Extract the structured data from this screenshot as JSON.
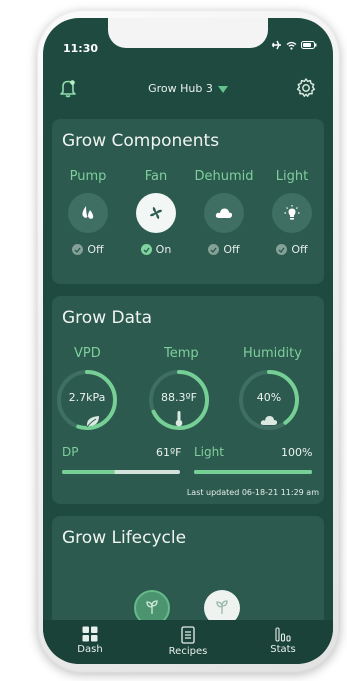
{
  "status_bar": {
    "time": "11:30"
  },
  "header": {
    "hub_name": "Grow Hub 3"
  },
  "components": {
    "title": "Grow Components",
    "items": [
      {
        "label": "Pump",
        "status": "Off",
        "icon": "drop-icon",
        "on": false
      },
      {
        "label": "Fan",
        "status": "On",
        "icon": "fan-icon",
        "on": true
      },
      {
        "label": "Dehumid",
        "status": "Off",
        "icon": "cloud-icon",
        "on": false
      },
      {
        "label": "Light",
        "status": "Off",
        "icon": "bulb-icon",
        "on": false
      }
    ]
  },
  "grow_data": {
    "title": "Grow Data",
    "gauges": [
      {
        "label": "VPD",
        "value": "2.7kPa",
        "fraction": 0.55,
        "icon": "leaf-icon"
      },
      {
        "label": "Temp",
        "value": "88.3ºF",
        "fraction": 0.68,
        "icon": "thermometer-icon"
      },
      {
        "label": "Humidity",
        "value": "40%",
        "fraction": 0.4,
        "icon": "cloud-icon"
      }
    ],
    "dp_label": "DP",
    "dp_value": "61ºF",
    "dp_fraction": 0.45,
    "light_label": "Light",
    "light_value": "100%",
    "light_fraction": 1.0,
    "last_updated": "Last updated 06-18-21 11:29 am"
  },
  "lifecycle": {
    "title": "Grow Lifecycle"
  },
  "tabs": [
    {
      "label": "Dash",
      "icon": "grid-icon"
    },
    {
      "label": "Recipes",
      "icon": "document-icon"
    },
    {
      "label": "Stats",
      "icon": "bar-chart-icon"
    }
  ],
  "colors": {
    "background": "#1e4a40",
    "card": "#2c5a4e",
    "accent": "#7fcf9d"
  }
}
